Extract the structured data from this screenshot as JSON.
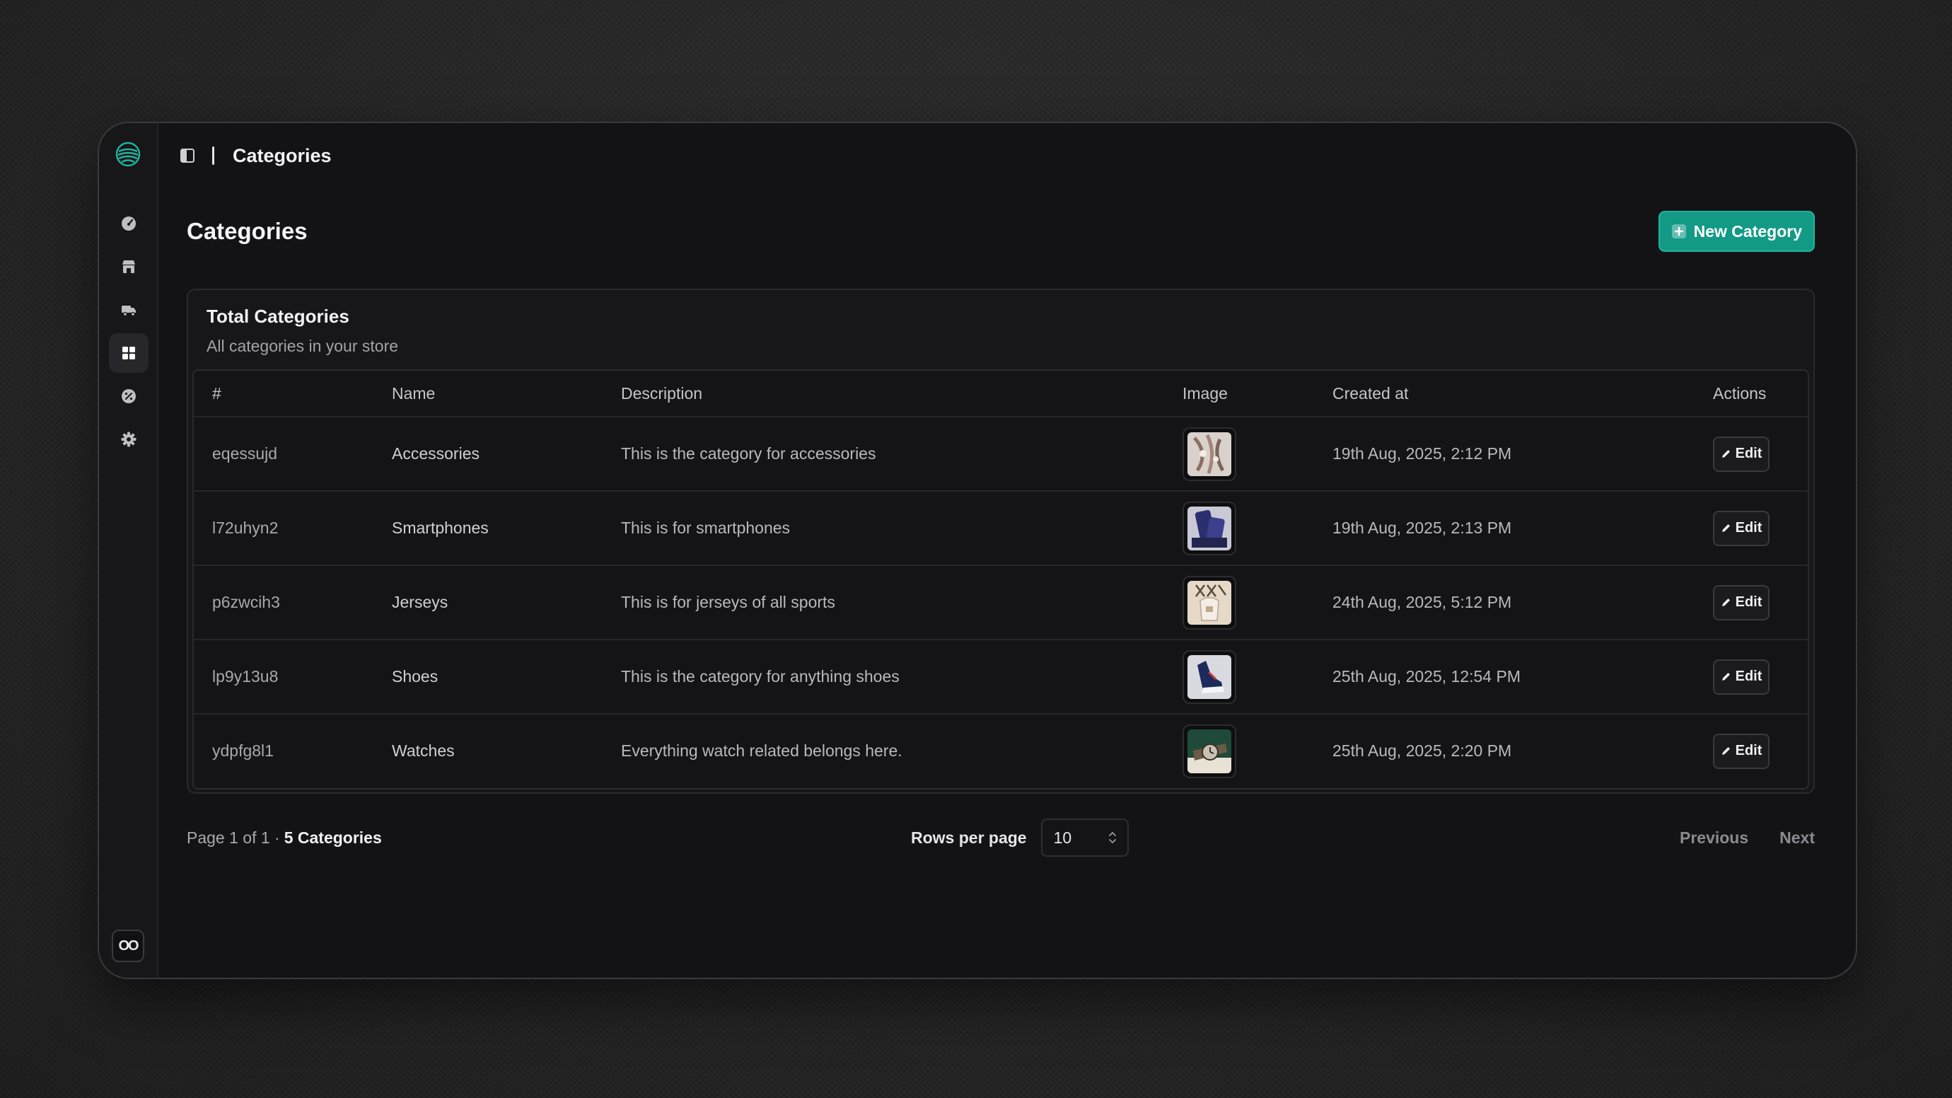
{
  "colors": {
    "accent": "#129a86",
    "window_bg": "#131315",
    "card_bg": "#17171a",
    "text": "#f2f2f4",
    "muted": "#a8a8ae"
  },
  "topbar": {
    "breadcrumb": "Categories",
    "toggle_icon": "sidebar-toggle-icon"
  },
  "sidebar": {
    "logo_icon": "spiral-logo-icon",
    "items": [
      {
        "icon": "dashboard-gauge-icon",
        "active": false
      },
      {
        "icon": "store-icon",
        "active": false
      },
      {
        "icon": "truck-icon",
        "active": false
      },
      {
        "icon": "grid-icon",
        "active": true
      },
      {
        "icon": "discount-icon",
        "active": false
      },
      {
        "icon": "gear-icon",
        "active": false
      }
    ],
    "user_badge": "OO"
  },
  "page": {
    "title": "Categories",
    "new_button": "New Category"
  },
  "card": {
    "title": "Total Categories",
    "subtitle": "All categories in your store"
  },
  "table": {
    "headers": [
      "#",
      "Name",
      "Description",
      "Image",
      "Created at",
      "Actions"
    ],
    "rows": [
      {
        "id": "eqessujd",
        "name": "Accessories",
        "description": "This is the category for accessories",
        "created": "19th Aug, 2025, 2:12 PM",
        "action": "Edit"
      },
      {
        "id": "l72uhyn2",
        "name": "Smartphones",
        "description": "This is for smartphones",
        "created": "19th Aug, 2025, 2:13 PM",
        "action": "Edit"
      },
      {
        "id": "p6zwcih3",
        "name": "Jerseys",
        "description": "This is for jerseys of all sports",
        "created": "24th Aug, 2025, 5:12 PM",
        "action": "Edit"
      },
      {
        "id": "lp9y13u8",
        "name": "Shoes",
        "description": "This is the category for anything shoes",
        "created": "25th Aug, 2025, 12:54 PM",
        "action": "Edit"
      },
      {
        "id": "ydpfg8l1",
        "name": "Watches",
        "description": "Everything watch related belongs here.",
        "created": "25th Aug, 2025, 2:20 PM",
        "action": "Edit"
      }
    ]
  },
  "footer": {
    "page_info": "Page 1 of 1 ·",
    "total": "5 Categories",
    "rows_label": "Rows per page",
    "rows_value": "10",
    "previous": "Previous",
    "next": "Next"
  }
}
